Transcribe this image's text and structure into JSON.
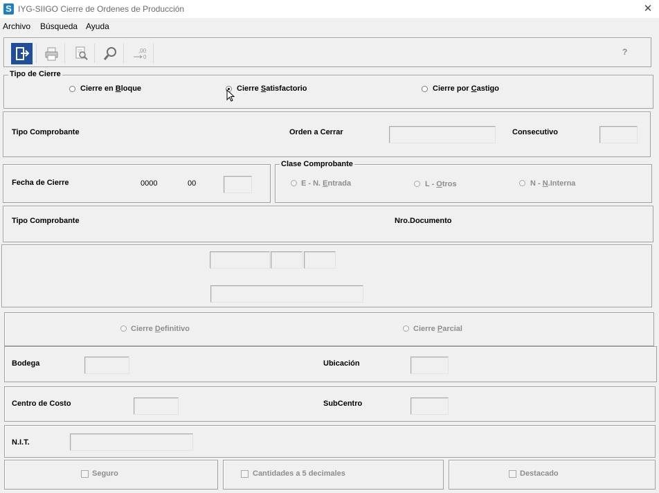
{
  "window": {
    "app_icon": "S",
    "title": "IYG-SIIGO Cierre de Ordenes de Producción",
    "close_glyph": "✕"
  },
  "menu": [
    "Archivo",
    "Búsqueda",
    "Ayuda"
  ],
  "toolbar": {
    "buttons": [
      {
        "icon": "exit-icon",
        "enabled": true
      },
      {
        "icon": "print-icon",
        "enabled": false
      },
      {
        "icon": "print-preview-icon",
        "enabled": false
      },
      {
        "icon": "search-icon",
        "enabled": false
      },
      {
        "icon": "decimal-shift-icon",
        "enabled": false
      }
    ],
    "decimal_icon_text": ",00",
    "decimal_icon_sub": "0",
    "help_label": "?"
  },
  "tipo_cierre": {
    "caption": "Tipo de Cierre",
    "options": [
      {
        "pre": "Cierre en ",
        "ul": "B",
        "post": "loque",
        "selected": false
      },
      {
        "pre": "Cierre ",
        "ul": "S",
        "post": "atisfactorio",
        "selected": true
      },
      {
        "pre": "Cierre por ",
        "ul": "C",
        "post": "astigo",
        "selected": false
      }
    ]
  },
  "row1": {
    "tipo_comprobante_label": "Tipo Comprobante",
    "orden_label": "Orden a Cerrar",
    "orden_value": "",
    "consecutivo_label": "Consecutivo",
    "consecutivo_value": ""
  },
  "fecha": {
    "label": "Fecha de Cierre",
    "year": "0000",
    "month": "00",
    "day_value": ""
  },
  "clase_comprobante": {
    "caption": "Clase Comprobante",
    "options": [
      {
        "pre": "E - N. ",
        "ul": "E",
        "post": "ntrada"
      },
      {
        "pre": "L - ",
        "ul": "O",
        "post": "tros"
      },
      {
        "pre": "N - ",
        "ul": "N",
        "post": ".Interna"
      }
    ]
  },
  "row3": {
    "tipo_comprobante_label": "Tipo Comprobante",
    "nro_documento_label": "Nro.Documento"
  },
  "cierre_modo": {
    "options": [
      {
        "pre": "Cierre ",
        "ul": "D",
        "post": "efinitivo"
      },
      {
        "pre": "Cierre ",
        "ul": "P",
        "post": "arcial"
      }
    ]
  },
  "bodega": {
    "label": "Bodega",
    "value": ""
  },
  "ubicacion": {
    "label": "Ubicación",
    "value": ""
  },
  "centro_costo": {
    "label": "Centro de Costo",
    "value": ""
  },
  "subcentro": {
    "label": "SubCentro",
    "value": ""
  },
  "nit": {
    "label": "N.I.T.",
    "value": ""
  },
  "checks": [
    {
      "label": "Seguro",
      "checked": false
    },
    {
      "label": "Cantidades a 5 decimales",
      "checked": false
    },
    {
      "label": "Destacado",
      "checked": false
    }
  ]
}
